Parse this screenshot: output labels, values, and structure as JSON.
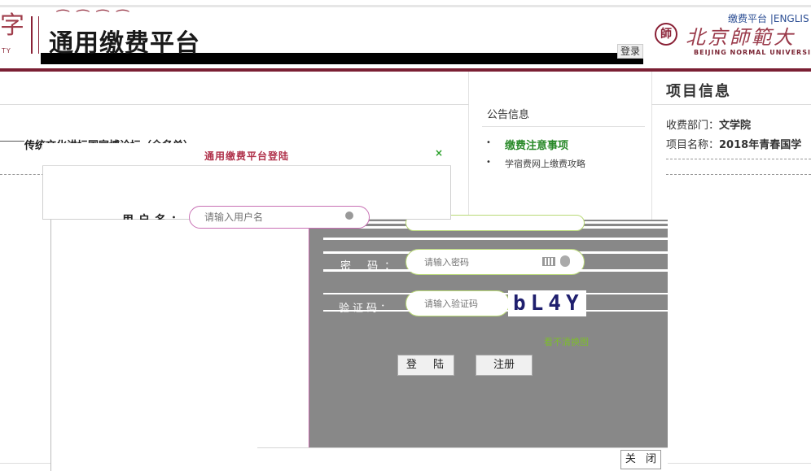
{
  "header": {
    "site_title": "通用缴费平台",
    "login_label": "登录",
    "top_links": "缴费平台 |ENGLIS",
    "univ_en": "BEIJING NORMAL UNIVERSI",
    "seal_text": "TY",
    "brand_color": "#7a1f33"
  },
  "main": {
    "article_title": "传统文化讲坛国家博论坛（全名单）"
  },
  "notice": {
    "title": "公告信息",
    "items": [
      {
        "label": "缴费注意事项"
      },
      {
        "label": "学宿费网上缴费攻略"
      }
    ]
  },
  "info": {
    "title": "项目信息",
    "dept_label": "收费部门：",
    "dept_value": "文学院",
    "proj_label": "项目名称：",
    "proj_value": "2018年青春国学"
  },
  "modal": {
    "title": "通用缴费平台登陆",
    "close_x": "×",
    "username_label": "用户名：",
    "username_placeholder": "请输入用户名",
    "password_label": "密 码：",
    "password_placeholder": "请输入密码",
    "captcha_label": "验证码：",
    "captcha_placeholder": "请输入验证码",
    "captcha_text": "bL4Y",
    "refresh_label": "看不清换图",
    "login_button": "登 陆",
    "register_button": "注册",
    "close_button": "关 闭"
  }
}
